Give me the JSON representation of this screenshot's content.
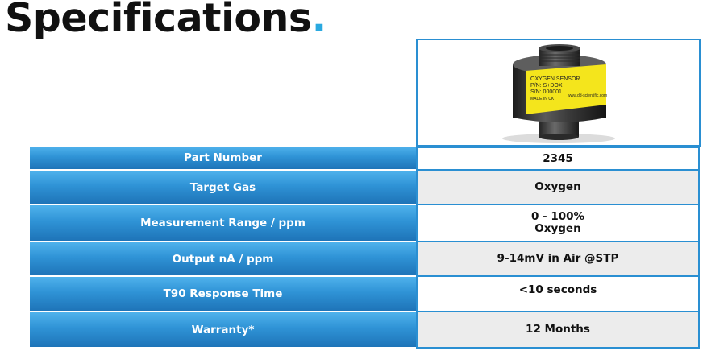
{
  "title": {
    "text": "Specifications",
    "dot": "."
  },
  "photo": {
    "alt": "oxygen-sensor",
    "label_lines": [
      "OXYGEN SENSOR",
      "P/N: S+DOX",
      "S/N: 000001",
      "MADE IN UK",
      "www.dd-scientific.com"
    ]
  },
  "specs": [
    {
      "label": "Part Number",
      "value_lines": [
        "2345"
      ]
    },
    {
      "label": "Target Gas",
      "value_lines": [
        "Oxygen"
      ]
    },
    {
      "label": "Measurement Range / ppm",
      "value_lines": [
        "0 - 100%",
        "Oxygen"
      ]
    },
    {
      "label": "Output nA / ppm",
      "value_lines": [
        "9-14mV in Air @STP"
      ]
    },
    {
      "label": "T90 Response Time",
      "value_lines": [
        "<10 seconds"
      ]
    },
    {
      "label": "Warranty*",
      "value_lines": [
        "12 Months"
      ]
    }
  ],
  "colors": {
    "accent_dot": "#2aa9e0",
    "header_blue": "#2f93d6",
    "border_blue": "#2a8fd2",
    "sensor_label": "#f4e51c"
  }
}
